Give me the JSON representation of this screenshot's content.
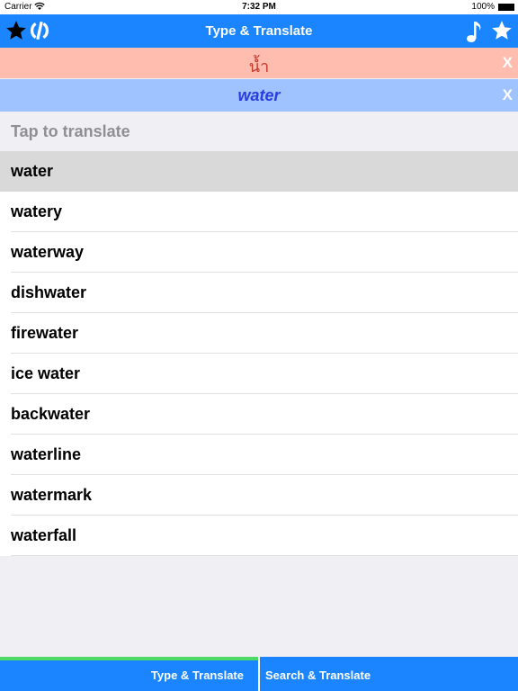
{
  "status_bar": {
    "carrier": "Carrier",
    "time": "7:32 PM",
    "battery": "100%"
  },
  "navbar": {
    "title": "Type & Translate"
  },
  "source_bar": {
    "text": "น้ำ",
    "close": "X"
  },
  "target_bar": {
    "text": "water",
    "close": "X"
  },
  "prompt": {
    "text": "Tap to translate"
  },
  "suggestions": [
    {
      "label": "water"
    },
    {
      "label": "watery"
    },
    {
      "label": "waterway"
    },
    {
      "label": "dishwater"
    },
    {
      "label": "firewater"
    },
    {
      "label": "ice water"
    },
    {
      "label": "backwater"
    },
    {
      "label": "waterline"
    },
    {
      "label": "watermark"
    },
    {
      "label": "waterfall"
    }
  ],
  "tabs": [
    {
      "label": "Type & Translate"
    },
    {
      "label": "Search & Translate"
    }
  ],
  "colors": {
    "accent": "#1a85ff",
    "active_tab": "#4cd964",
    "source_bg": "#ffbdb0",
    "target_bg": "#9fc3ff",
    "selected_row": "#d9d9d9"
  }
}
